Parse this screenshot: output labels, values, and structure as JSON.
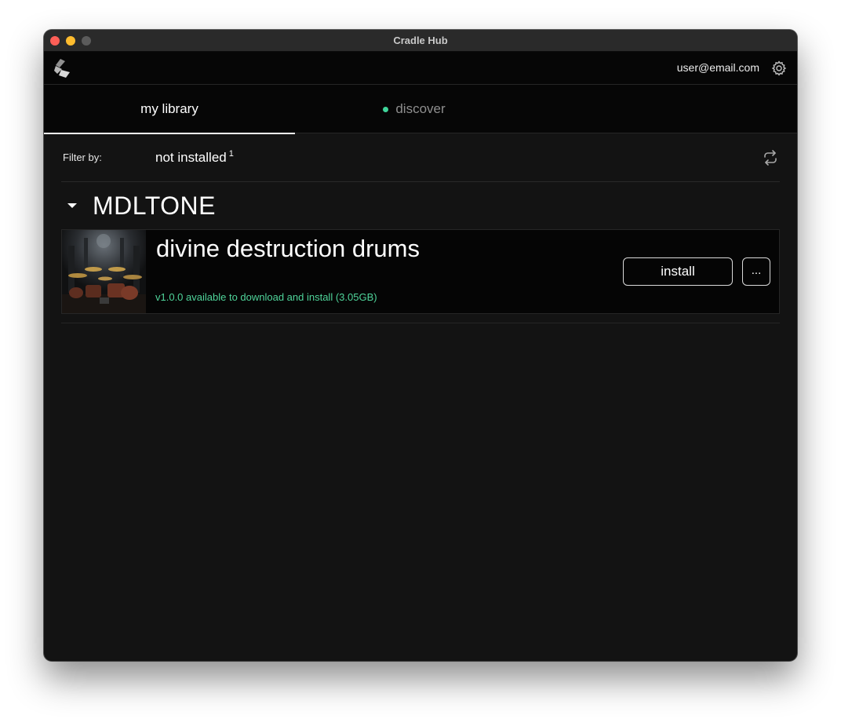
{
  "window": {
    "title": "Cradle Hub"
  },
  "header": {
    "user_email": "user@email.com"
  },
  "tabs": [
    {
      "label": "my library",
      "active": true
    },
    {
      "label": "discover",
      "active": false,
      "has_indicator": true
    }
  ],
  "filter": {
    "label": "Filter by:",
    "value": "not installed",
    "count": "1"
  },
  "groups": [
    {
      "name": "MDLTONE",
      "expanded": true,
      "items": [
        {
          "title": "divine destruction drums",
          "status": "v1.0.0 available to download and install (3.05GB)",
          "install_label": "install",
          "more_label": "..."
        }
      ]
    }
  ],
  "colors": {
    "background": "#131313",
    "header_bg": "#060606",
    "accent_green": "#4fd49a",
    "text": "#ffffff",
    "muted_text": "#8e8e8e"
  },
  "icons": {
    "logo": "cradle-logo-icon",
    "settings": "gear-icon",
    "refresh": "refresh-icon",
    "expand": "caret-down-icon"
  }
}
